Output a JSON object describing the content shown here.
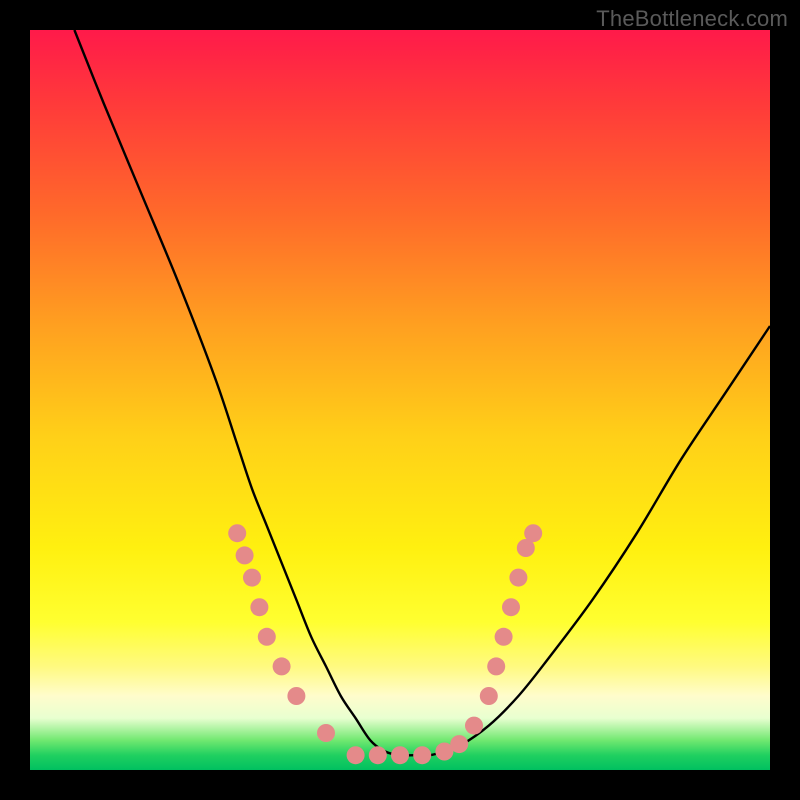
{
  "watermark": "TheBottleneck.com",
  "chart_data": {
    "type": "line",
    "title": "",
    "xlabel": "",
    "ylabel": "",
    "xlim": [
      0,
      100
    ],
    "ylim": [
      0,
      100
    ],
    "series": [
      {
        "name": "bottleneck-curve",
        "x": [
          6,
          10,
          15,
          20,
          25,
          28,
          30,
          32,
          34,
          36,
          38,
          40,
          42,
          44,
          46,
          48,
          50,
          52,
          54,
          56,
          58,
          62,
          66,
          70,
          76,
          82,
          88,
          94,
          100
        ],
        "y": [
          100,
          90,
          78,
          66,
          53,
          44,
          38,
          33,
          28,
          23,
          18,
          14,
          10,
          7,
          4,
          2.5,
          2,
          2,
          2,
          2.5,
          3.2,
          6,
          10,
          15,
          23,
          32,
          42,
          51,
          60
        ]
      }
    ],
    "markers": {
      "name": "highlight-points",
      "color": "#e48a8a",
      "radius_px": 9,
      "points": [
        {
          "x": 28,
          "y": 32
        },
        {
          "x": 29,
          "y": 29
        },
        {
          "x": 30,
          "y": 26
        },
        {
          "x": 31,
          "y": 22
        },
        {
          "x": 32,
          "y": 18
        },
        {
          "x": 34,
          "y": 14
        },
        {
          "x": 36,
          "y": 10
        },
        {
          "x": 40,
          "y": 5
        },
        {
          "x": 44,
          "y": 2
        },
        {
          "x": 47,
          "y": 2
        },
        {
          "x": 50,
          "y": 2
        },
        {
          "x": 53,
          "y": 2
        },
        {
          "x": 56,
          "y": 2.5
        },
        {
          "x": 58,
          "y": 3.5
        },
        {
          "x": 60,
          "y": 6
        },
        {
          "x": 62,
          "y": 10
        },
        {
          "x": 63,
          "y": 14
        },
        {
          "x": 64,
          "y": 18
        },
        {
          "x": 65,
          "y": 22
        },
        {
          "x": 66,
          "y": 26
        },
        {
          "x": 67,
          "y": 30
        },
        {
          "x": 68,
          "y": 32
        }
      ]
    }
  }
}
